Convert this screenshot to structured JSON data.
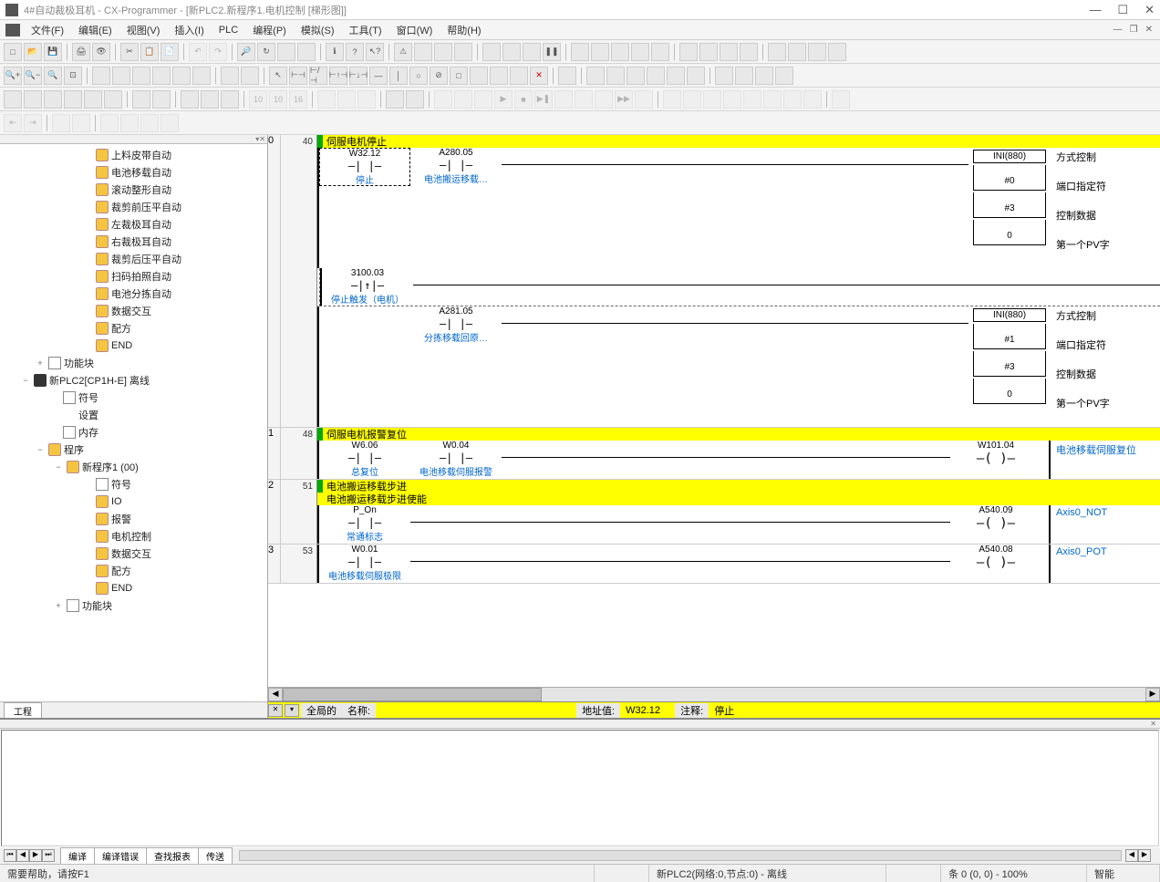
{
  "window": {
    "title": "4#自动裁极耳机 - CX-Programmer - [新PLC2.新程序1.电机控制 [梯形图]]",
    "min": "—",
    "max": "☐",
    "close": "✕"
  },
  "menu": {
    "items": [
      "文件(F)",
      "编辑(E)",
      "视图(V)",
      "插入(I)",
      "PLC",
      "编程(P)",
      "模拟(S)",
      "工具(T)",
      "窗口(W)",
      "帮助(H)"
    ],
    "mdi_min": "—",
    "mdi_restore": "❐",
    "mdi_close": "✕"
  },
  "tree": {
    "tab": "工程",
    "nodes": [
      {
        "indent": 90,
        "icon": "yellow",
        "label": "上料皮带自动"
      },
      {
        "indent": 90,
        "icon": "yellow",
        "label": "电池移载自动"
      },
      {
        "indent": 90,
        "icon": "yellow",
        "label": "滚动整形自动"
      },
      {
        "indent": 90,
        "icon": "yellow",
        "label": "裁剪前压平自动"
      },
      {
        "indent": 90,
        "icon": "yellow",
        "label": "左裁极耳自动"
      },
      {
        "indent": 90,
        "icon": "yellow",
        "label": "右裁极耳自动"
      },
      {
        "indent": 90,
        "icon": "yellow",
        "label": "裁剪后压平自动"
      },
      {
        "indent": 90,
        "icon": "yellow",
        "label": "扫码拍照自动"
      },
      {
        "indent": 90,
        "icon": "yellow",
        "label": "电池分拣自动"
      },
      {
        "indent": 90,
        "icon": "yellow",
        "label": "数据交互"
      },
      {
        "indent": 90,
        "icon": "yellow",
        "label": "配方"
      },
      {
        "indent": 90,
        "icon": "yellow",
        "label": "END"
      },
      {
        "indent": 38,
        "exp": "+",
        "icon": "doc",
        "label": "功能块"
      },
      {
        "indent": 22,
        "exp": "−",
        "icon": "plc",
        "label": "新PLC2[CP1H-E] 离线"
      },
      {
        "indent": 54,
        "icon": "doc",
        "label": "符号"
      },
      {
        "indent": 54,
        "icon": "gear",
        "label": "设置"
      },
      {
        "indent": 54,
        "icon": "doc",
        "label": "内存"
      },
      {
        "indent": 38,
        "exp": "−",
        "icon": "yellow",
        "label": "程序"
      },
      {
        "indent": 58,
        "exp": "−",
        "icon": "yellow",
        "label": "新程序1 (00)"
      },
      {
        "indent": 90,
        "icon": "doc",
        "label": "符号"
      },
      {
        "indent": 90,
        "icon": "yellow",
        "label": "IO"
      },
      {
        "indent": 90,
        "icon": "yellow",
        "label": "报警"
      },
      {
        "indent": 90,
        "icon": "yellow",
        "label": "电机控制"
      },
      {
        "indent": 90,
        "icon": "yellow",
        "label": "数据交互"
      },
      {
        "indent": 90,
        "icon": "yellow",
        "label": "配方"
      },
      {
        "indent": 90,
        "icon": "yellow",
        "label": "END"
      },
      {
        "indent": 58,
        "exp": "+",
        "icon": "doc",
        "label": "功能块"
      }
    ]
  },
  "ladder": {
    "rungs": [
      {
        "num": "0",
        "step": "40",
        "title": "伺服电机停止",
        "rows": [
          {
            "contacts": [
              {
                "addr": "W32.12",
                "sym": "—| |—",
                "comment": "停止",
                "selected": true
              },
              {
                "addr": "A280.05",
                "sym": "—| |—",
                "comment": "电池搬运移载…"
              }
            ],
            "box": {
              "name": "INI(880)",
              "params": [
                "#0",
                "#3",
                "0"
              ]
            },
            "labels": [
              "方式控制",
              "端口指定符",
              "控制数据",
              "第一个PV字"
            ]
          },
          {
            "branch": true,
            "contacts": [
              {
                "addr": "3100.03",
                "sym": "—|↑|—",
                "comment": "停止触发（电机）"
              }
            ]
          },
          {
            "contacts": [
              {
                "addr": "",
                "sym": "",
                "comment": ""
              },
              {
                "addr": "A281.05",
                "sym": "—| |—",
                "comment": "分拣移载回原…"
              }
            ],
            "box": {
              "name": "INI(880)",
              "params": [
                "#1",
                "#3",
                "0"
              ]
            },
            "labels": [
              "方式控制",
              "端口指定符",
              "控制数据",
              "第一个PV字"
            ]
          }
        ]
      },
      {
        "num": "1",
        "step": "48",
        "title": "伺服电机报警复位",
        "rows": [
          {
            "contacts": [
              {
                "addr": "W6.06",
                "sym": "—| |—",
                "comment": "总复位"
              },
              {
                "addr": "W0.04",
                "sym": "—| |—",
                "comment": "电池移载伺服报警"
              }
            ],
            "coil": {
              "addr": "W101.04",
              "sym": "—( )—",
              "comment": "电池移载伺服复位"
            }
          }
        ]
      },
      {
        "num": "2",
        "step": "51",
        "title": "电池搬运移载步进",
        "title2": "电池搬运移载步进使能",
        "rows": [
          {
            "contacts": [
              {
                "addr": "P_On",
                "sym": "—| |—",
                "comment": "常通标志"
              }
            ],
            "coil": {
              "addr": "A540.09",
              "sym": "—( )—",
              "comment": "Axis0_NOT"
            }
          }
        ]
      },
      {
        "num": "3",
        "step": "53",
        "title": "",
        "rows": [
          {
            "contacts": [
              {
                "addr": "W0.01",
                "sym": "—| |—",
                "comment": "电池移载伺服极限"
              }
            ],
            "coil": {
              "addr": "A540.08",
              "sym": "—( )—",
              "comment": "Axis0_POT"
            }
          }
        ]
      }
    ]
  },
  "info": {
    "scope": "全局的",
    "name_label": "名称:",
    "name_value": "",
    "addr_label": "地址值:",
    "addr_value": "W32.12",
    "comment_label": "注释:",
    "comment_value": "停止"
  },
  "output_tabs": [
    "编译",
    "编译错误",
    "查找报表",
    "传送"
  ],
  "status": {
    "help": "需要帮助，请按F1",
    "plc": "新PLC2(网络:0,节点:0) - 离线",
    "rung": "条 0 (0, 0) - 100%",
    "mode": "智能"
  },
  "icons": {
    "new": "□",
    "open": "📂",
    "save": "💾",
    "print": "🖨",
    "preview": "🔍",
    "cut": "✂",
    "copy": "📋",
    "paste": "📄",
    "undo": "↶",
    "redo": "↷",
    "find": "🔎",
    "help": "?",
    "zoom_in": "+",
    "zoom_out": "−"
  }
}
